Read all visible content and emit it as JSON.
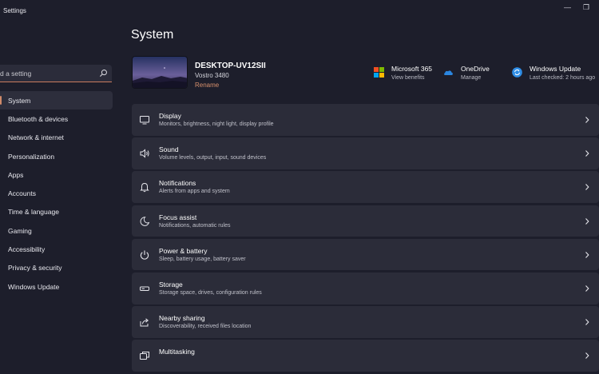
{
  "window": {
    "title": "Settings",
    "minimize": "—",
    "maximize": "❐"
  },
  "search": {
    "placeholder": "d a setting"
  },
  "sidebar": {
    "items": [
      {
        "label": "System",
        "active": true
      },
      {
        "label": "Bluetooth & devices"
      },
      {
        "label": "Network & internet"
      },
      {
        "label": "Personalization"
      },
      {
        "label": "Apps"
      },
      {
        "label": "Accounts"
      },
      {
        "label": "Time & language"
      },
      {
        "label": "Gaming"
      },
      {
        "label": "Accessibility"
      },
      {
        "label": "Privacy & security"
      },
      {
        "label": "Windows Update"
      }
    ]
  },
  "page": {
    "title": "System"
  },
  "device": {
    "name": "DESKTOP-UV12SII",
    "model": "Vostro 3480",
    "rename_label": "Rename"
  },
  "quick_links": [
    {
      "title": "Microsoft 365",
      "subtitle": "View benefits",
      "icon": "microsoft-logo-icon"
    },
    {
      "title": "OneDrive",
      "subtitle": "Manage",
      "icon": "onedrive-cloud-icon"
    },
    {
      "title": "Windows Update",
      "subtitle": "Last checked: 2 hours ago",
      "icon": "windows-update-icon"
    }
  ],
  "settings": [
    {
      "title": "Display",
      "description": "Monitors, brightness, night light, display profile",
      "icon": "display-icon"
    },
    {
      "title": "Sound",
      "description": "Volume levels, output, input, sound devices",
      "icon": "speaker-icon"
    },
    {
      "title": "Notifications",
      "description": "Alerts from apps and system",
      "icon": "bell-icon"
    },
    {
      "title": "Focus assist",
      "description": "Notifications, automatic rules",
      "icon": "moon-icon"
    },
    {
      "title": "Power & battery",
      "description": "Sleep, battery usage, battery saver",
      "icon": "power-icon"
    },
    {
      "title": "Storage",
      "description": "Storage space, drives, configuration rules",
      "icon": "storage-icon"
    },
    {
      "title": "Nearby sharing",
      "description": "Discoverability, received files location",
      "icon": "share-icon"
    },
    {
      "title": "Multitasking",
      "description": "",
      "icon": "multitasking-icon"
    }
  ],
  "colors": {
    "accent": "#d08a6a",
    "background": "#1d1e2b",
    "card": "#2b2c39"
  }
}
